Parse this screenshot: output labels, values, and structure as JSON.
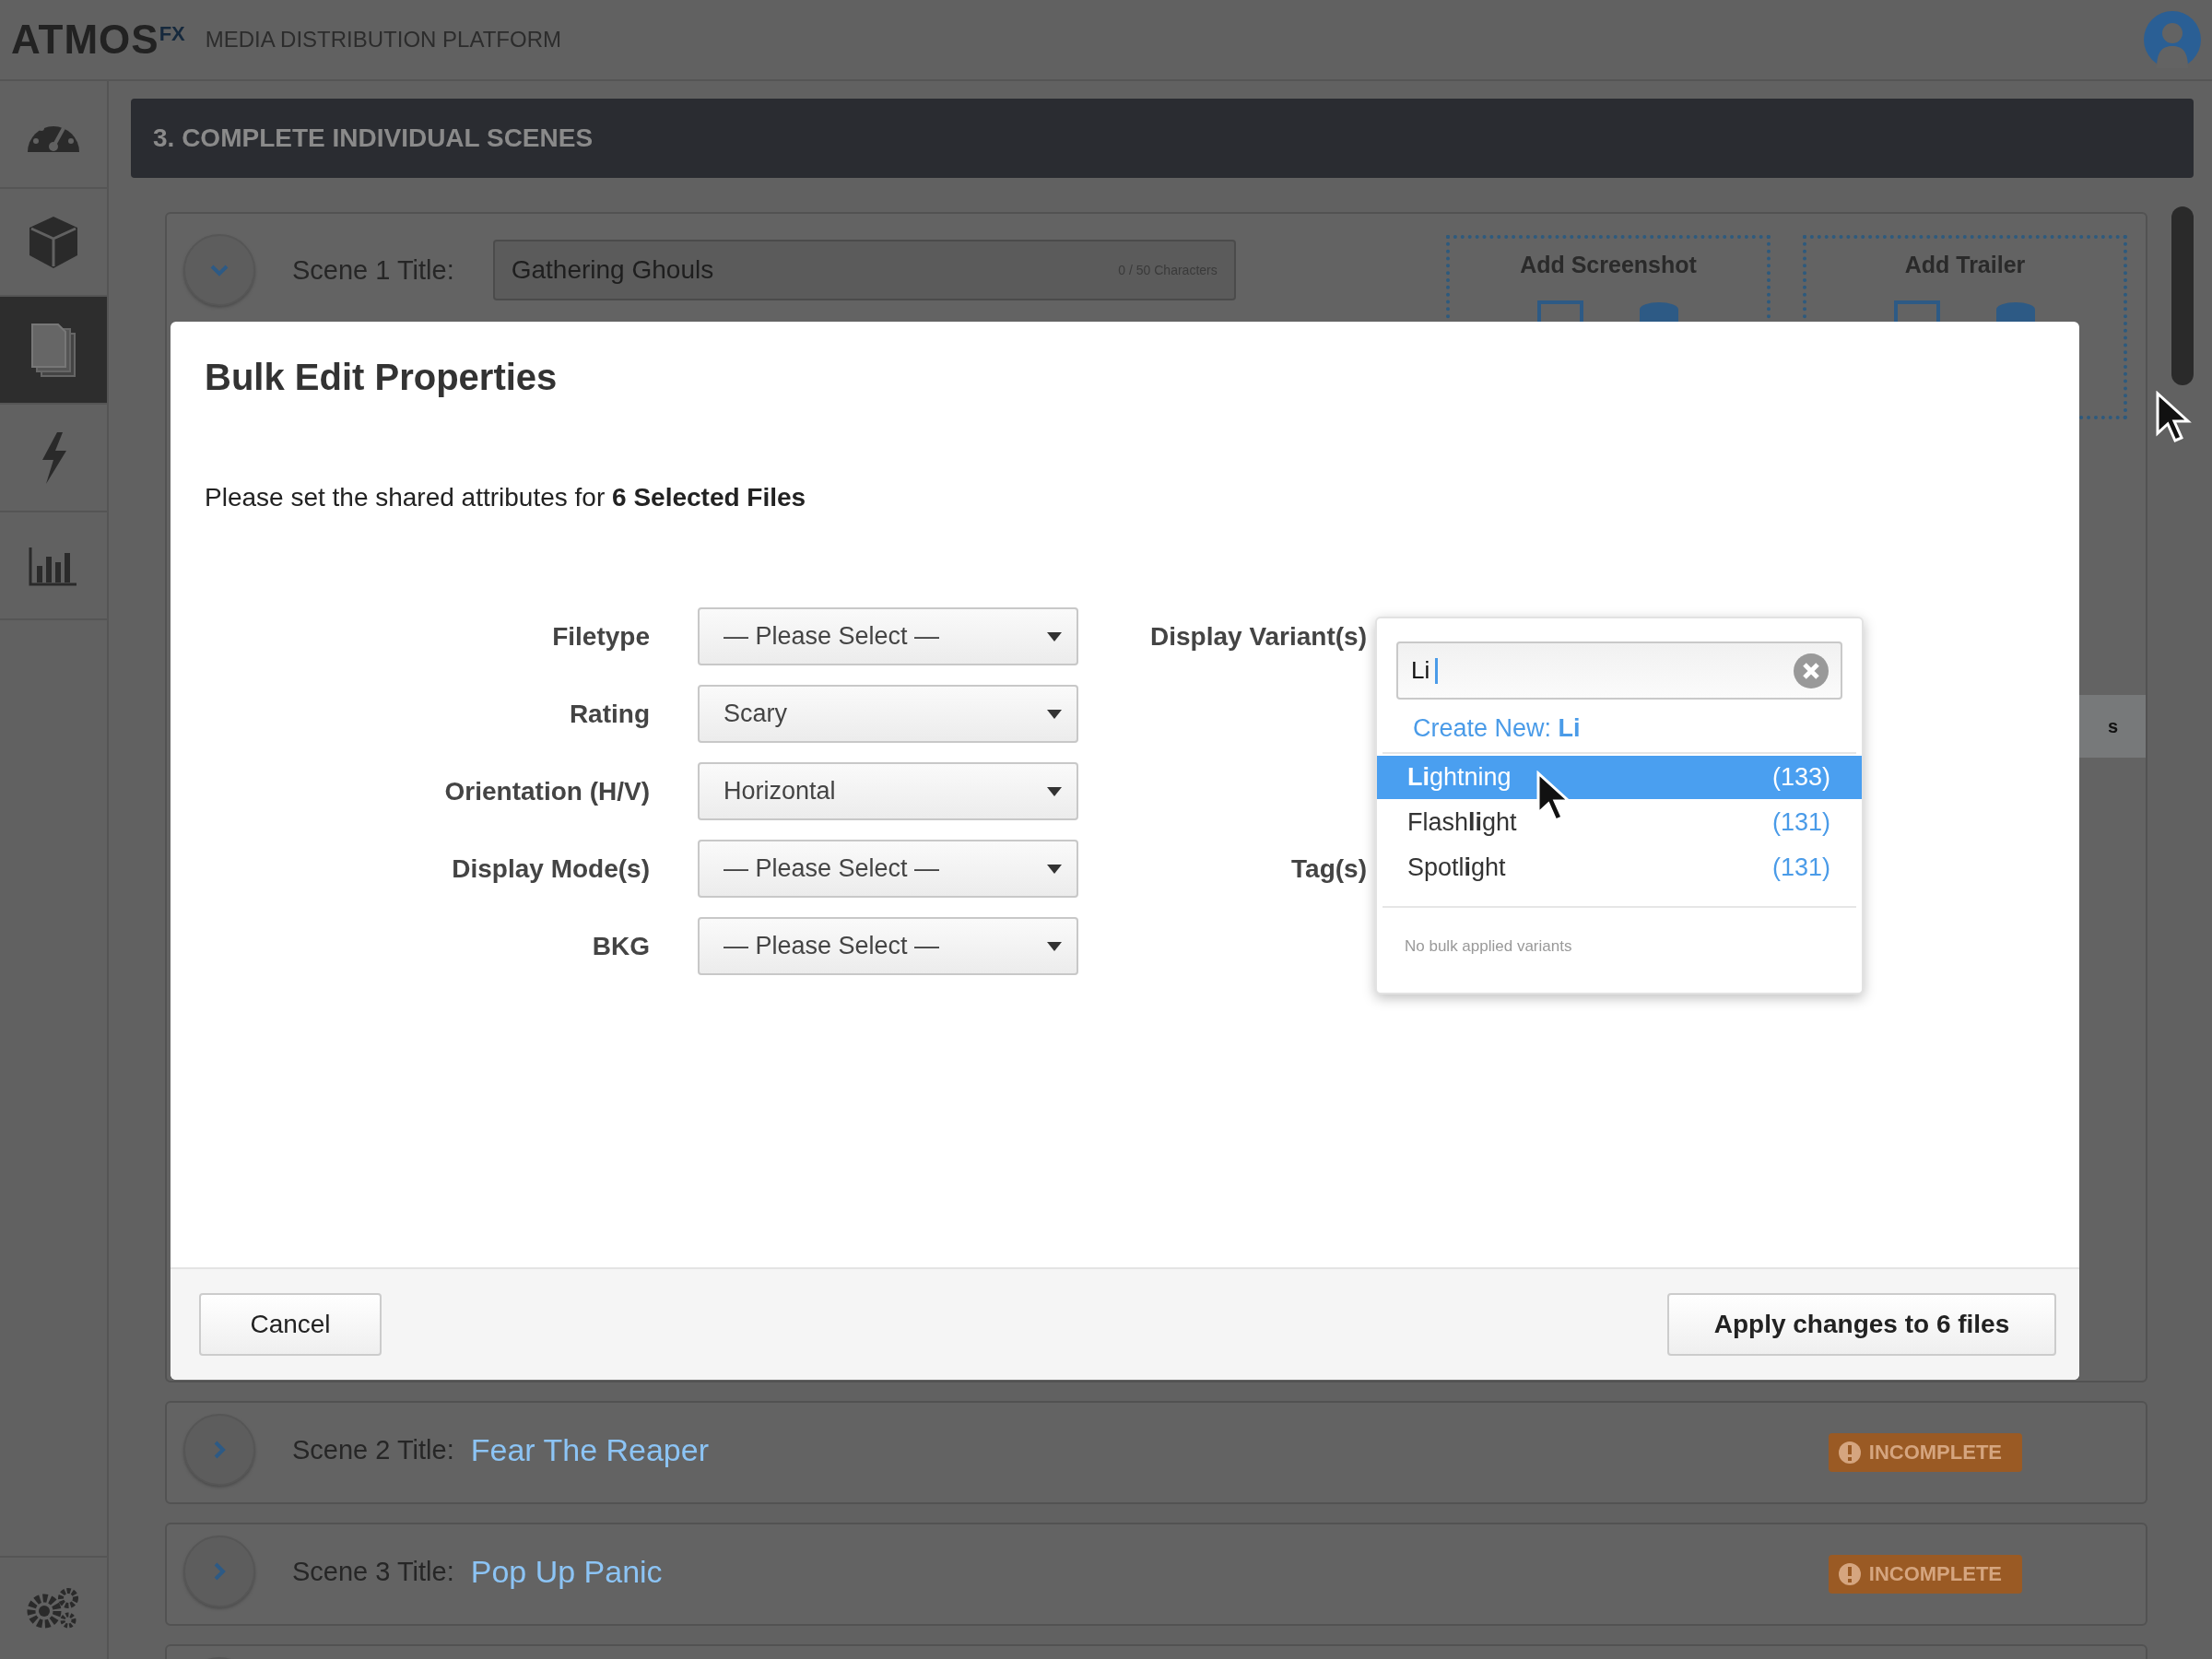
{
  "header": {
    "logo": "ATMOS",
    "logo_superscript": "FX",
    "tagline": "MEDIA DISTRIBUTION PLATFORM"
  },
  "sidebar": {
    "items": [
      {
        "kind": "gauge",
        "selected": false
      },
      {
        "kind": "cube",
        "selected": false
      },
      {
        "kind": "documents",
        "selected": true
      },
      {
        "kind": "lightning",
        "selected": false
      },
      {
        "kind": "chart",
        "selected": false
      }
    ]
  },
  "section_title": "3. COMPLETE INDIVIDUAL SCENES",
  "scenes": [
    {
      "label": "Scene 1 Title:",
      "title": "Gathering Ghouls",
      "expanded": true,
      "counter": "0 / 50 Characters",
      "uploads": [
        "Add Screenshot",
        "Add Trailer"
      ],
      "side_fragment": "s"
    },
    {
      "label": "Scene 2 Title:",
      "title": "Fear The Reaper",
      "expanded": false,
      "status": "INCOMPLETE"
    },
    {
      "label": "Scene 3 Title:",
      "title": "Pop Up Panic",
      "expanded": false,
      "status": "INCOMPLETE"
    },
    {
      "expanded": false
    }
  ],
  "modal": {
    "title": "Bulk Edit Properties",
    "intro": "Please set the shared attributes for **6 Selected Files**",
    "fields": [
      {
        "label": "Filetype",
        "value": "— Please Select —",
        "right_label": "Display Variant(s)"
      },
      {
        "label": "Rating",
        "value": "Scary"
      },
      {
        "label": "Orientation (H/V)",
        "value": "Horizontal"
      },
      {
        "label": "Display Mode(s)",
        "value": "— Please Select —",
        "right_label": "Tag(s)"
      },
      {
        "label": "BKG",
        "value": "— Please Select —"
      }
    ],
    "variant_dropdown": {
      "search": "Li",
      "create_new": "Create New: **Li**",
      "options": [
        {
          "label": "**Li**ghtning",
          "count": "(133)",
          "selected": true
        },
        {
          "label": "Flash**li**ght",
          "count": "(131)",
          "selected": false
        },
        {
          "label": "Spotl**i**ght",
          "count": "(131)",
          "selected": false
        }
      ],
      "note": "No bulk applied variants"
    },
    "cancel": "Cancel",
    "apply": "Apply changes to 6 files"
  }
}
